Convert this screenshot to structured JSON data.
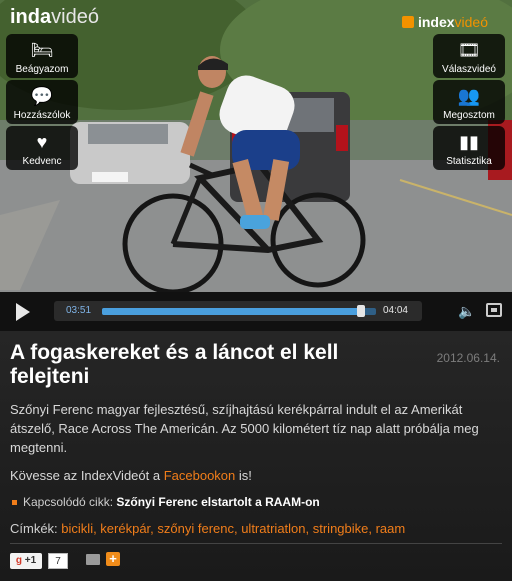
{
  "player": {
    "brand_left_bold": "inda",
    "brand_left_light": "videó",
    "brand_right_bold": "index",
    "brand_right_light": "videó",
    "left_buttons": [
      {
        "label": "Beágyazom",
        "icon": "bed-icon"
      },
      {
        "label": "Hozzászólok",
        "icon": "comment-icon"
      },
      {
        "label": "Kedvenc",
        "icon": "heart-icon"
      }
    ],
    "right_buttons": [
      {
        "label": "Válaszvideó",
        "icon": "film-reply-icon"
      },
      {
        "label": "Megosztom",
        "icon": "people-icon"
      },
      {
        "label": "Statisztika",
        "icon": "bar-chart-icon"
      }
    ],
    "current_time": "03:51",
    "duration": "04:04",
    "progress_fraction": 0.944
  },
  "article": {
    "title": "A fogaskereket és a láncot el kell felejteni",
    "date": "2012.06.14.",
    "description": "Szőnyi Ferenc magyar fejlesztésű, szíjhajtású kerékpárral indult el az Amerikát átszelő, Race Across The Americán. Az 5000 kilométert tíz nap alatt próbálja meg megtenni.",
    "follow_prefix": "Kövesse az IndexVideót a ",
    "follow_link": "Facebookon",
    "follow_suffix": " is!",
    "related_label": "Kapcsolódó cikk:",
    "related_link": "Szőnyi Ferenc elstartolt a RAAM-on",
    "tags_label": "Címkék:",
    "tags": "bicikli, kerékpár, szőnyi ferenc, ultratriatlon, stringbike, raam"
  },
  "social": {
    "gplus_label": "+1",
    "gplus_count": "7"
  },
  "colors": {
    "accent_orange": "#f07d1a",
    "progress_blue": "#4a9fde"
  }
}
